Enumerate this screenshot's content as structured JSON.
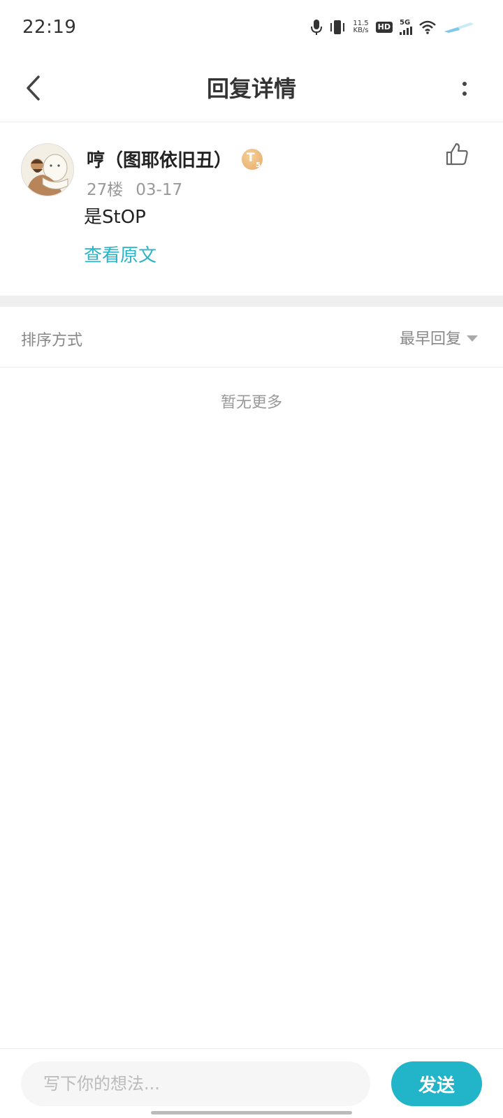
{
  "status_bar": {
    "time": "22:19",
    "net_speed_value": "11.5",
    "net_speed_unit": "KB/s",
    "hd_label": "HD",
    "network_label": "5G",
    "icons": [
      "mic-icon",
      "vibrate-icon",
      "hd-icon",
      "signal-icon",
      "wifi-icon",
      "battery-icon"
    ]
  },
  "nav": {
    "title": "回复详情"
  },
  "reply": {
    "username": "哼（图耶依旧丑）",
    "level_badge_letter": "T",
    "level_badge_number": "5",
    "floor": "27楼",
    "date": "03-17",
    "content": "是StOP",
    "view_original_label": "查看原文"
  },
  "sort": {
    "label": "排序方式",
    "selected": "最早回复"
  },
  "list": {
    "empty_text": "暂无更多"
  },
  "composer": {
    "placeholder": "写下你的想法...",
    "value": "",
    "send_label": "发送"
  },
  "colors": {
    "accent": "#22b4c9",
    "link": "#2bb3c8",
    "badge": "#e7a968"
  }
}
